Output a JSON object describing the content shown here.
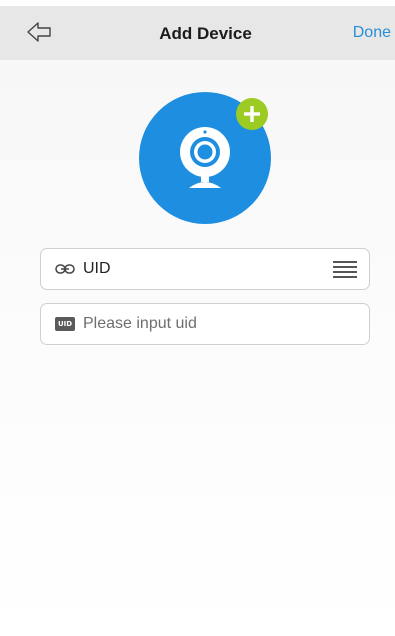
{
  "header": {
    "title": "Add Device",
    "done_label": "Done",
    "back_icon": "back-arrow-icon"
  },
  "device": {
    "avatar_icon": "webcam-icon",
    "add_icon": "plus-circle-icon",
    "accent_color": "#1e8fe0",
    "add_color": "#9ccb24"
  },
  "uid_field": {
    "label": "UID",
    "link_icon": "link-icon",
    "menu_icon": "menu-lines-icon"
  },
  "uid_input": {
    "badge": "UID",
    "placeholder": "Please input uid",
    "value": ""
  }
}
